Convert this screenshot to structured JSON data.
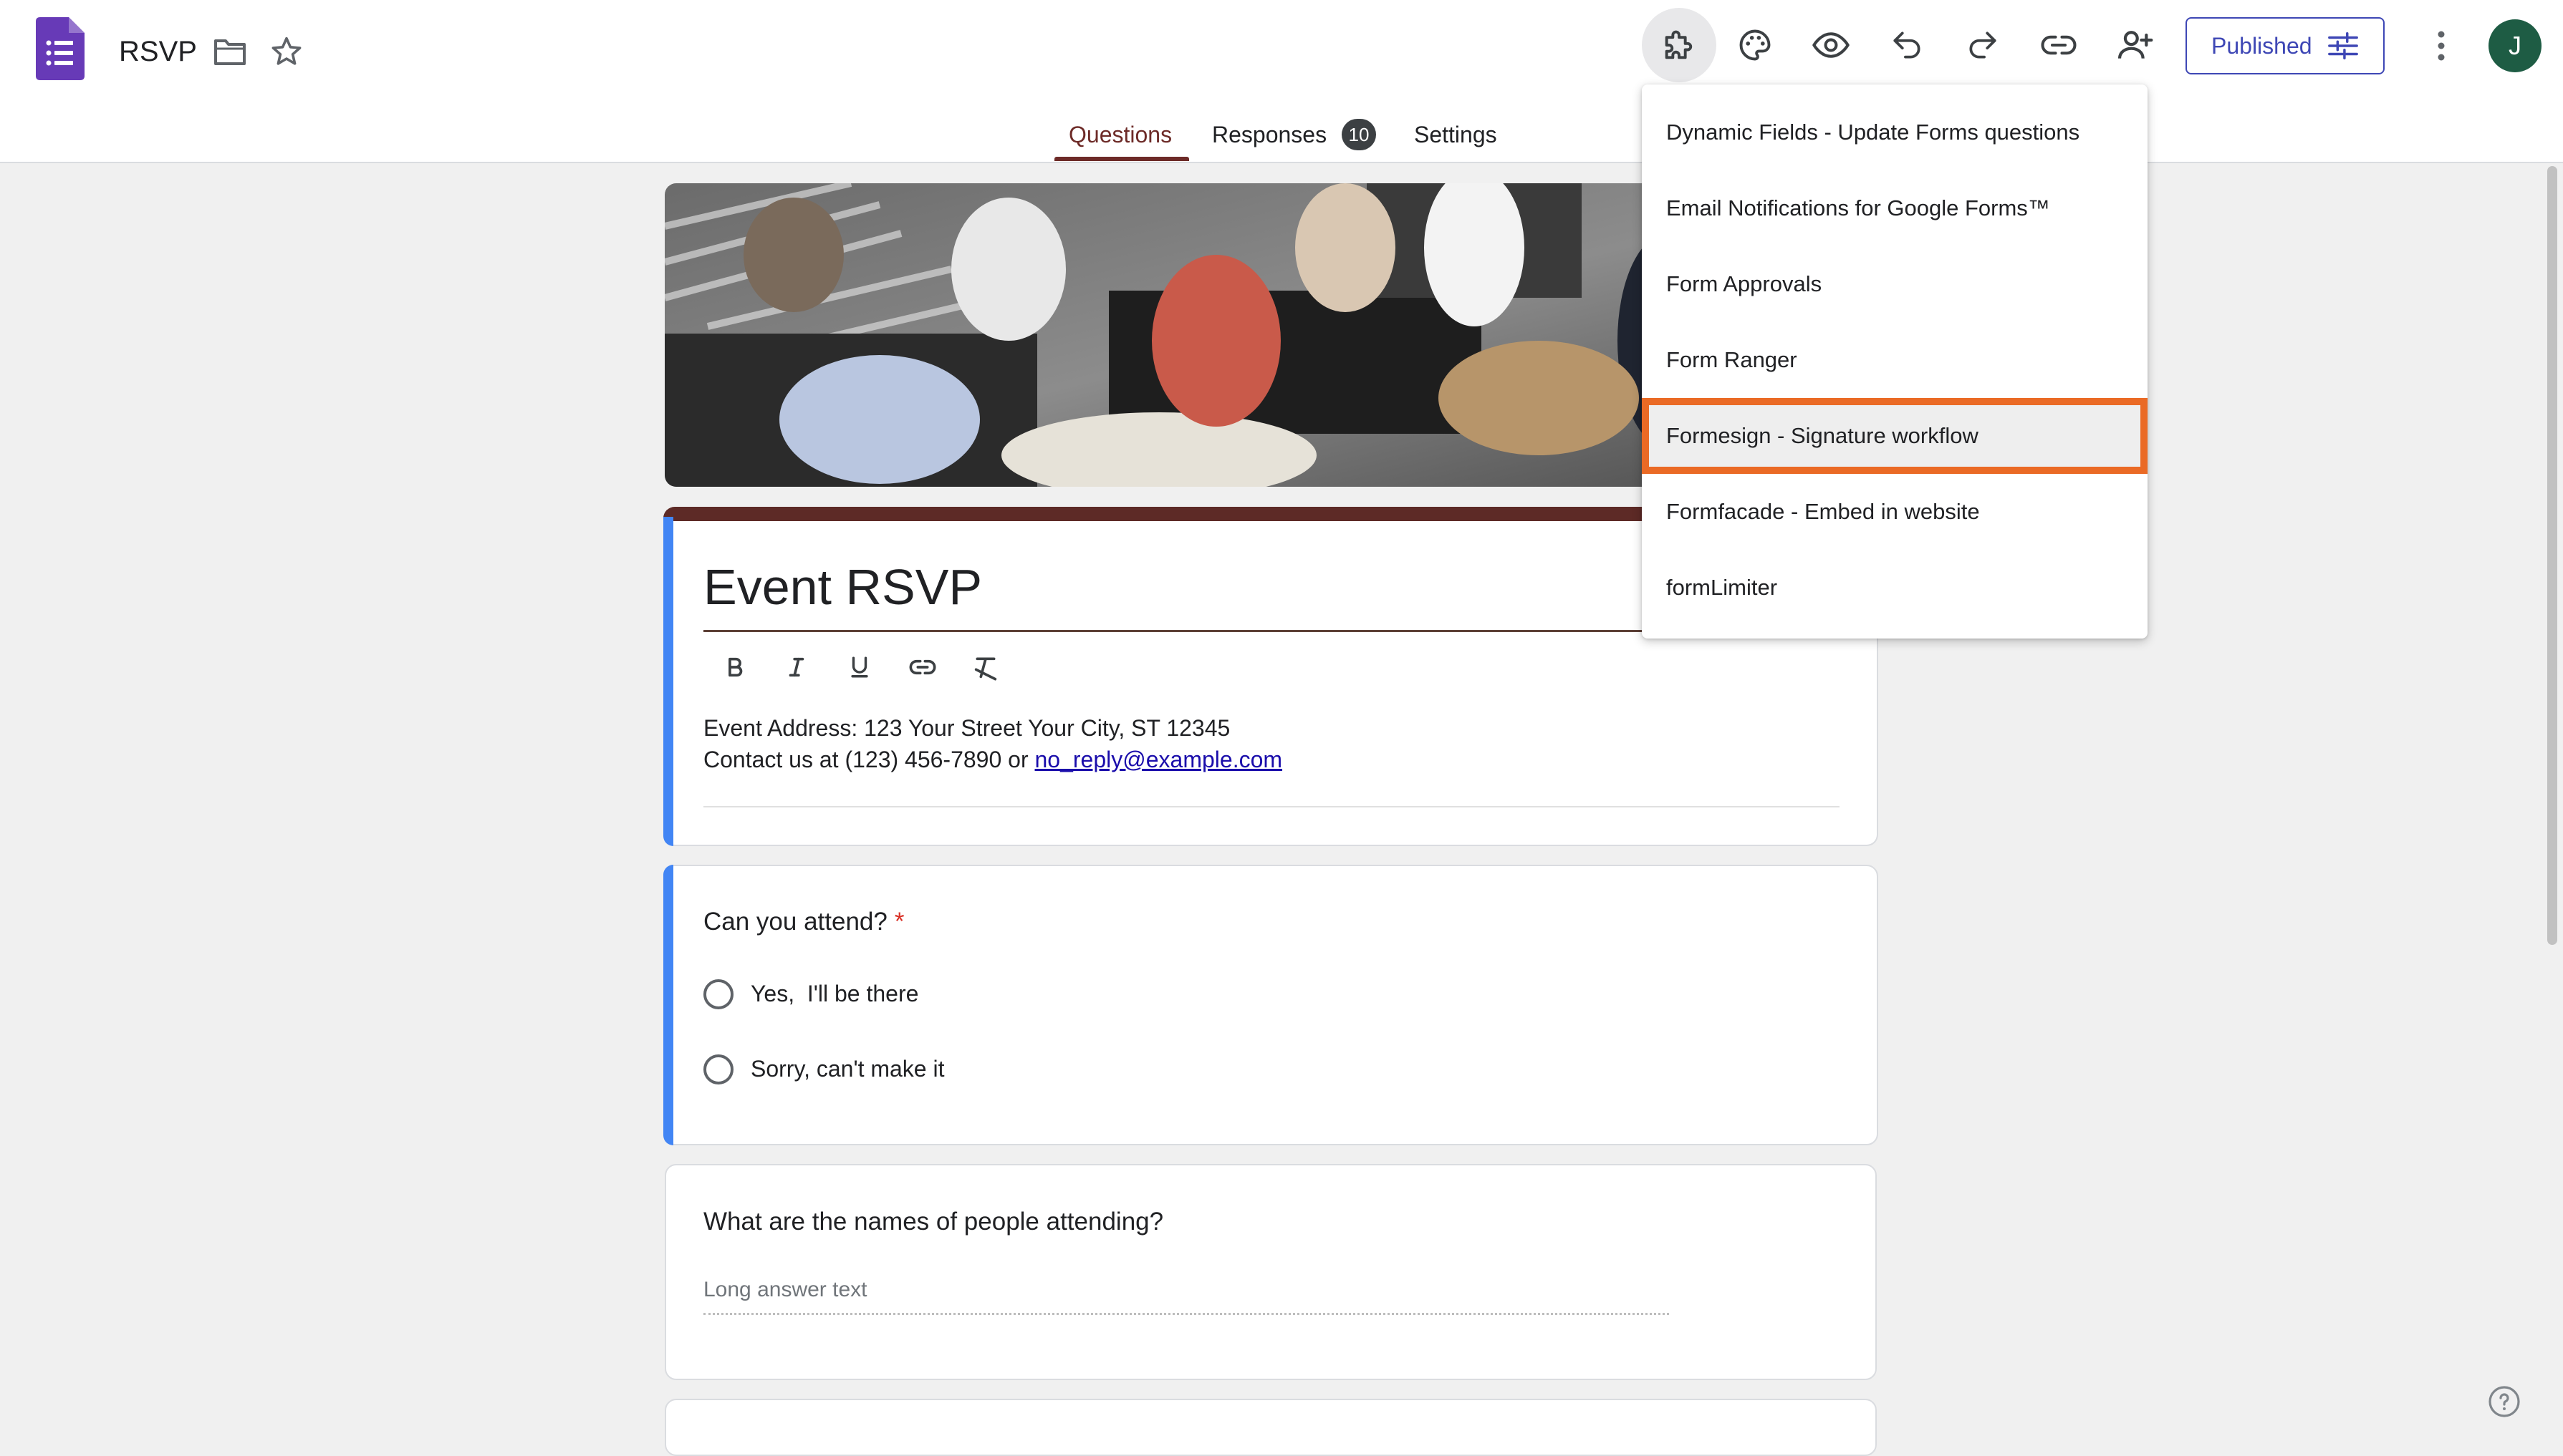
{
  "app": {
    "doc_title": "RSVP",
    "icons": [
      "forms-logo-icon",
      "folder-icon",
      "star-icon",
      "puzzle-addons-icon",
      "palette-icon",
      "eye-preview-icon",
      "undo-icon",
      "redo-icon",
      "link-icon",
      "add-person-icon",
      "sliders-icon",
      "more-vert-icon",
      "help-icon"
    ]
  },
  "header": {
    "publish_label": "Published",
    "avatar_initial": "J"
  },
  "tabs": [
    {
      "label": "Questions",
      "active": true
    },
    {
      "label": "Responses",
      "badge": "10"
    },
    {
      "label": "Settings"
    }
  ],
  "form": {
    "title": "Event RSVP",
    "description_line1": "Event Address: 123 Your Street Your City, ST 12345",
    "description_line2_prefix": "Contact us at (123) 456-7890 or ",
    "description_email": "no_reply@example.com"
  },
  "questions": [
    {
      "title": "Can you attend?",
      "required_mark": "*",
      "options": [
        "Yes,  I'll be there",
        "Sorry, can't make it"
      ]
    },
    {
      "title": "What are the names of people attending?",
      "placeholder": "Long answer text"
    }
  ],
  "addons_menu": {
    "items": [
      "Dynamic Fields - Update Forms questions",
      "Email Notifications for Google Forms™",
      "Form Approvals",
      "Form Ranger",
      "Formesign - Signature workflow",
      "Formfacade - Embed in website",
      "formLimiter"
    ],
    "highlighted_index": 4
  },
  "colors": {
    "theme_dark_red": "#6d2b28",
    "focus_blue": "#4285f4",
    "publish_blue": "#3e47b5",
    "forms_purple": "#673ab7",
    "highlight_orange": "#ea6a25",
    "avatar_green": "#1e5c44"
  }
}
